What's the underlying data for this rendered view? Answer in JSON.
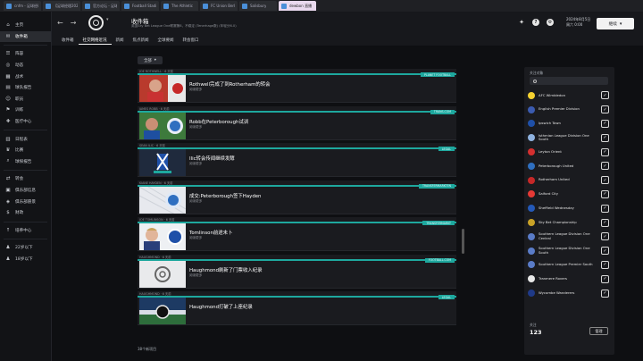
{
  "browser": {
    "tabs": [
      {
        "label": "cnfm - 足球经理"
      },
      {
        "label": "【足球经理2024】"
      },
      {
        "label": "官方论坛 - 足球"
      },
      {
        "label": "Football Stadium"
      },
      {
        "label": "The Athletic"
      },
      {
        "label": "FC Union Berlin"
      },
      {
        "label": "Salisbury"
      },
      {
        "label": "dewbon 直播"
      }
    ]
  },
  "nav": {
    "items": [
      {
        "label": "主页",
        "icon": "home-icon",
        "glyph": "⌂"
      },
      {
        "label": "收件箱",
        "icon": "inbox-icon",
        "glyph": "✉",
        "active": true
      },
      {
        "label": "阵容",
        "icon": "squad-icon",
        "glyph": "☰"
      },
      {
        "label": "动态",
        "icon": "dynamics-icon",
        "glyph": "◎"
      },
      {
        "label": "战术",
        "icon": "tactics-icon",
        "glyph": "▦"
      },
      {
        "label": "球队报告",
        "icon": "report-icon",
        "glyph": "▤"
      },
      {
        "label": "职员",
        "icon": "staff-icon",
        "glyph": "☺"
      },
      {
        "label": "训练",
        "icon": "training-icon",
        "glyph": "⚑"
      },
      {
        "label": "医疗中心",
        "icon": "medical-icon",
        "glyph": "✚"
      },
      {
        "label": "日程表",
        "icon": "calendar-icon",
        "glyph": "▥"
      },
      {
        "label": "比赛",
        "icon": "trophy-icon",
        "glyph": "♛"
      },
      {
        "label": "球探报告",
        "icon": "scouting-icon",
        "glyph": "⌕"
      },
      {
        "label": "转会",
        "icon": "transfers-icon",
        "glyph": "⇄"
      },
      {
        "label": "俱乐部信息",
        "icon": "club-info-icon",
        "glyph": "▣"
      },
      {
        "label": "俱乐部愿景",
        "icon": "vision-icon",
        "glyph": "◈"
      },
      {
        "label": "财政",
        "icon": "finances-icon",
        "glyph": "$"
      },
      {
        "label": "培养中心",
        "icon": "development-icon",
        "glyph": "↑"
      },
      {
        "label": "22岁以下",
        "icon": "u22-icon",
        "glyph": "♟"
      },
      {
        "label": "18岁以下",
        "icon": "u18-icon",
        "glyph": "♟"
      }
    ]
  },
  "header": {
    "title": "收件箱",
    "subtitle": "英国Sky Bet League One联赛第8，不稳定 (Tenerhage数) (年轻分6.0)",
    "date_line1": "2024年8月5日",
    "date_line2": "周六 0:00",
    "continue_label": "继续",
    "tabs": [
      {
        "label": "收件箱"
      },
      {
        "label": "社交网络近况",
        "active": true
      },
      {
        "label": "新闻"
      },
      {
        "label": "焦点新闻"
      },
      {
        "label": "全球要闻"
      },
      {
        "label": "转会窗口"
      }
    ]
  },
  "feed": {
    "filter_label": "全部",
    "count_label": "38个新项目",
    "cards": [
      {
        "meta": "JOE ROTHWELL · 6 天前",
        "badge": "PLANET FOOTBALL",
        "headline": "Rothwell完成了到Rotherham的转会",
        "readmore": "阅读更多",
        "thumb": "player"
      },
      {
        "meta": "JAMES ROBB · 6 天前",
        "badge": "TRANS.COM",
        "headline": "Robb在Peterborough试训",
        "readmore": "阅读更多",
        "thumb": "player-crest"
      },
      {
        "meta": "SEAN ILIC · 6 天前",
        "badge": "LEGAL",
        "headline": "Ilic转会传闻继续发酵",
        "readmore": "阅读更多",
        "thumb": "flag"
      },
      {
        "meta": "KIANE HAYDEN · 6 天前",
        "badge": "TRANSFERMARKTEN",
        "headline": "成交:Peterborough签下Hayden",
        "readmore": "阅读更多",
        "thumb": "crest-net"
      },
      {
        "meta": "JOE TOMLINSON · 6 天前",
        "badge": "TRANSFERMARKT",
        "headline": "Tomlinson前途未卜",
        "readmore": "阅读更多",
        "thumb": "player-crest2"
      },
      {
        "meta": "HAUGHMOND · 6 天前",
        "badge": "FOOTBALL.COM",
        "headline": "Haughmond刷新了门票收入纪录",
        "readmore": "阅读更多",
        "thumb": "logo"
      },
      {
        "meta": "HAUGHMOND · 6 天前",
        "badge": "LEGAL",
        "headline": "Haughmond打破了上座纪录",
        "readmore": "",
        "thumb": "stadium"
      }
    ]
  },
  "followed": {
    "title": "关注对象",
    "search_placeholder": "",
    "count_label": "关注",
    "count_value": "123",
    "manage_label": "管理",
    "clubs": [
      {
        "name": "AFC Wimbledon",
        "color": "#f5d130"
      },
      {
        "name": "English Premier Division",
        "color": "#3b5bb0"
      },
      {
        "name": "Ipswich Town",
        "color": "#1f50a8"
      },
      {
        "name": "Isthmian League Division One South",
        "color": "#8fb3e0"
      },
      {
        "name": "Leyton Orient",
        "color": "#d32f2f"
      },
      {
        "name": "Peterborough United",
        "color": "#2f6fc0"
      },
      {
        "name": "Rotherham United",
        "color": "#c62828"
      },
      {
        "name": "Salford City",
        "color": "#e53935"
      },
      {
        "name": "Sheffield Wednesday",
        "color": "#2459b8"
      },
      {
        "name": "Sky Bet Championship",
        "color": "#c9a227"
      },
      {
        "name": "Southern League Division One Central",
        "color": "#5a7cc8"
      },
      {
        "name": "Southern League Division One South",
        "color": "#5a7cc8"
      },
      {
        "name": "Southern League Premier South",
        "color": "#5a7cc8"
      },
      {
        "name": "Tranmere Rovers",
        "color": "#e8e8e8"
      },
      {
        "name": "Wycombe Wanderers",
        "color": "#1f3a88"
      }
    ]
  },
  "colors": {
    "accent": "#1ea89e"
  }
}
